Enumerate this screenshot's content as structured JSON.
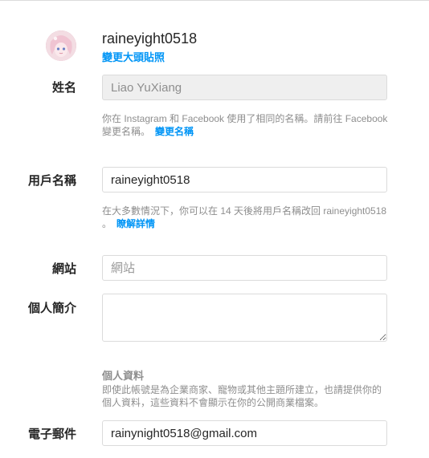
{
  "profile": {
    "username": "raineyight0518",
    "change_photo_label": "變更大頭貼照"
  },
  "name": {
    "label": "姓名",
    "value": "Liao YuXiang",
    "helper_text": "你在 Instagram 和 Facebook 使用了相同的名稱。請前往 Facebook 變更名稱。",
    "helper_link": "變更名稱"
  },
  "username": {
    "label": "用戶名稱",
    "value": "raineyight0518",
    "helper_text": "在大多數情況下，你可以在 14 天後將用戶名稱改回 raineyight0518 。",
    "helper_link": "瞭解詳情"
  },
  "website": {
    "label": "網站",
    "placeholder": "網站",
    "value": ""
  },
  "bio": {
    "label": "個人簡介",
    "value": ""
  },
  "personal_info": {
    "heading": "個人資料",
    "description": "即使此帳號是為企業商家、寵物或其他主題所建立，也請提供你的個人資料，這些資料不會顯示在你的公開商業檔案。"
  },
  "email": {
    "label": "電子郵件",
    "value": "rainynight0518@gmail.com"
  },
  "colors": {
    "link": "#0095f6",
    "text": "#262626",
    "muted": "#8e8e8e",
    "border": "#dbdbdb"
  }
}
